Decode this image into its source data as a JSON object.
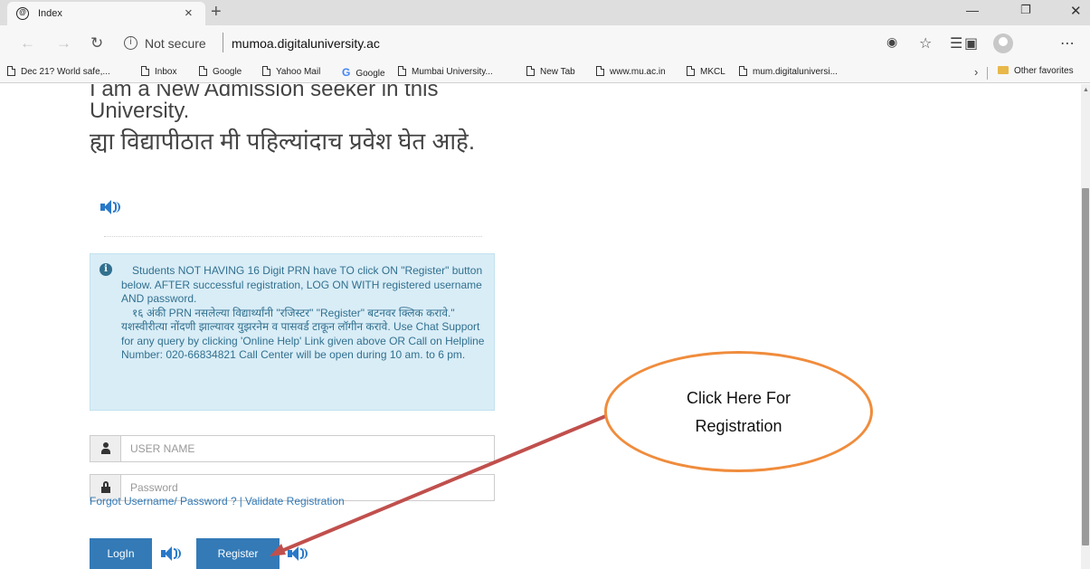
{
  "browser": {
    "tab_title": "Index",
    "tab_close": "×",
    "new_tab": "+",
    "url_security": "Not secure",
    "url_host": "mumoa.digitaluniversity.ac",
    "bookmarks": [
      {
        "label": "Dec 21? World safe,...",
        "icon": "page-icon"
      },
      {
        "label": "Inbox",
        "icon": "page-icon"
      },
      {
        "label": "Google",
        "icon": "page-icon"
      },
      {
        "label": "Yahoo Mail",
        "icon": "page-icon"
      },
      {
        "label": "Google",
        "icon": "google-icon"
      },
      {
        "label": "Mumbai University...",
        "icon": "page-icon"
      },
      {
        "label": "New Tab",
        "icon": "page-icon"
      },
      {
        "label": "www.mu.ac.in",
        "icon": "page-icon"
      },
      {
        "label": "MKCL",
        "icon": "page-icon"
      },
      {
        "label": "mum.digitaluniversi...",
        "icon": "page-icon"
      }
    ],
    "other_favorites": "Other favorites"
  },
  "page": {
    "heading_en": "I am a New Admission seeker in this University.",
    "heading_mr": "ह्या विद्यापीठात मी पहिल्यांदाच प्रवेश घेत आहे.",
    "info_lines": [
      "Students NOT HAVING 16 Digit PRN have TO click ON \"Register\" button below. AFTER successful registration, LOG ON WITH registered username AND password.",
      "१६ अंकी PRN नसलेल्या विद्यार्थ्यांनी \"रजिस्टर\" \"Register\" बटनवर क्लिक करावे.\" यशस्वीरीत्या नोंदणी झाल्यावर युझरनेम व पासवर्ड टाकून लॉगीन करावे. Use Chat Support for any query by clicking 'Online Help' Link given above OR Call on Helpline Number: 020-66834821 Call Center will be open during 10 am. to 6 pm."
    ],
    "username_placeholder": "USER NAME",
    "password_placeholder": "Password",
    "forgot_link": "Forgot Username/ Password ?",
    "link_sep": "|",
    "validate_link": "Validate Registration",
    "login_label": "LogIn",
    "register_label": "Register"
  },
  "annotation": {
    "line1": "Click Here For",
    "line2": "Registration",
    "border_color": "#f08c3c",
    "arrow_color": "#c0504d"
  },
  "colors": {
    "accent": "#337ab7",
    "info_bg": "#d9edf7",
    "info_text": "#31708f"
  }
}
